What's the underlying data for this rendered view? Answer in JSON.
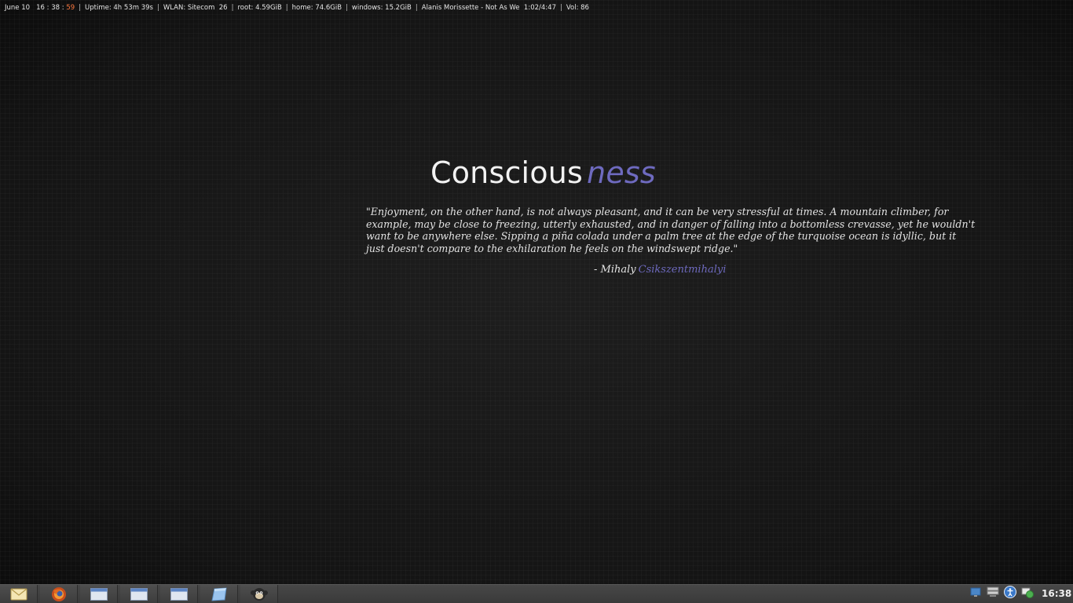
{
  "statusbar": {
    "date": "June 10",
    "time_hm": "16 : 38 : ",
    "time_sec": "59",
    "uptime": "Uptime: 4h 53m 39s",
    "wlan": "WLAN: Sitecom  26",
    "root": "root: 4.59GiB",
    "home": "home: 74.6GiB",
    "windows": "windows: 15.2GiB",
    "now_playing": "Alanis Morissette - Not As We  1:02/4:47",
    "volume": "Vol: 86",
    "separator": "|"
  },
  "wallpaper": {
    "title_main": "Conscious",
    "title_accent": "ness",
    "quote": "\"Enjoyment, on the other hand, is not always pleasant, and it can be very stressful at times. A mountain climber, for example, may be close to freezing, utterly exhausted, and in danger of falling into a bottomless crevasse, yet he wouldn't want to be anywhere else. Sipping a piña colada under a palm tree at the edge of the turquoise ocean is idyllic, but it just doesn't compare to the exhilaration he feels on the windswept ridge.\"",
    "author_prefix": "- Mihaly",
    "author_surname": "Csikszentmihalyi"
  },
  "taskbar": {
    "launchers": [
      {
        "icon": "mail-icon"
      },
      {
        "icon": "firefox-icon"
      },
      {
        "icon": "window-icon"
      },
      {
        "icon": "window-icon"
      },
      {
        "icon": "window-icon"
      },
      {
        "icon": "file-manager-icon"
      },
      {
        "icon": "monkey-icon"
      }
    ],
    "tray": [
      {
        "icon": "network-icon"
      },
      {
        "icon": "display-icon"
      },
      {
        "icon": "accessibility-icon"
      },
      {
        "icon": "update-icon"
      }
    ],
    "clock": "16:38"
  },
  "colors": {
    "accent": "#6e6abf",
    "seconds": "#ff7a40",
    "text": "#e2e2e2",
    "background": "#161616",
    "taskbar": "#3d3d3d"
  }
}
